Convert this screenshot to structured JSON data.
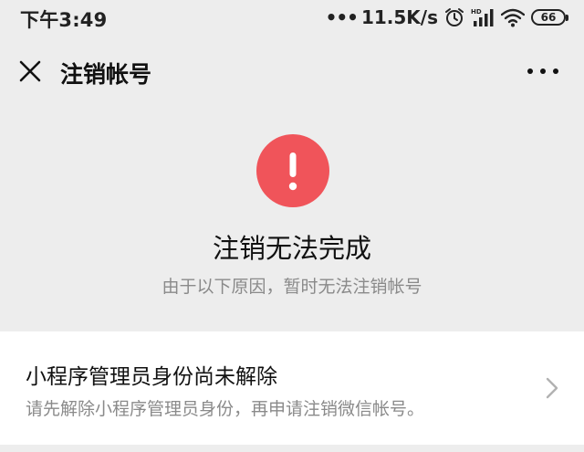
{
  "status_bar": {
    "time": "下午3:49",
    "dots": "•••",
    "speed": "11.5K/s",
    "icons": [
      "alarm-icon",
      "hd-signal-icon",
      "wifi-icon"
    ],
    "hd_label": "HD",
    "battery": "66"
  },
  "nav": {
    "close_icon": "close-icon",
    "title": "注销帐号",
    "more_icon": "more-icon"
  },
  "result": {
    "icon": "warning-icon",
    "icon_color": "#f0545a",
    "title": "注销无法完成",
    "subtitle": "由于以下原因，暂时无法注销帐号"
  },
  "reason": {
    "title": "小程序管理员身份尚未解除",
    "description": "请先解除小程序管理员身份，再申请注销微信帐号。",
    "chevron_icon": "chevron-right-icon"
  }
}
